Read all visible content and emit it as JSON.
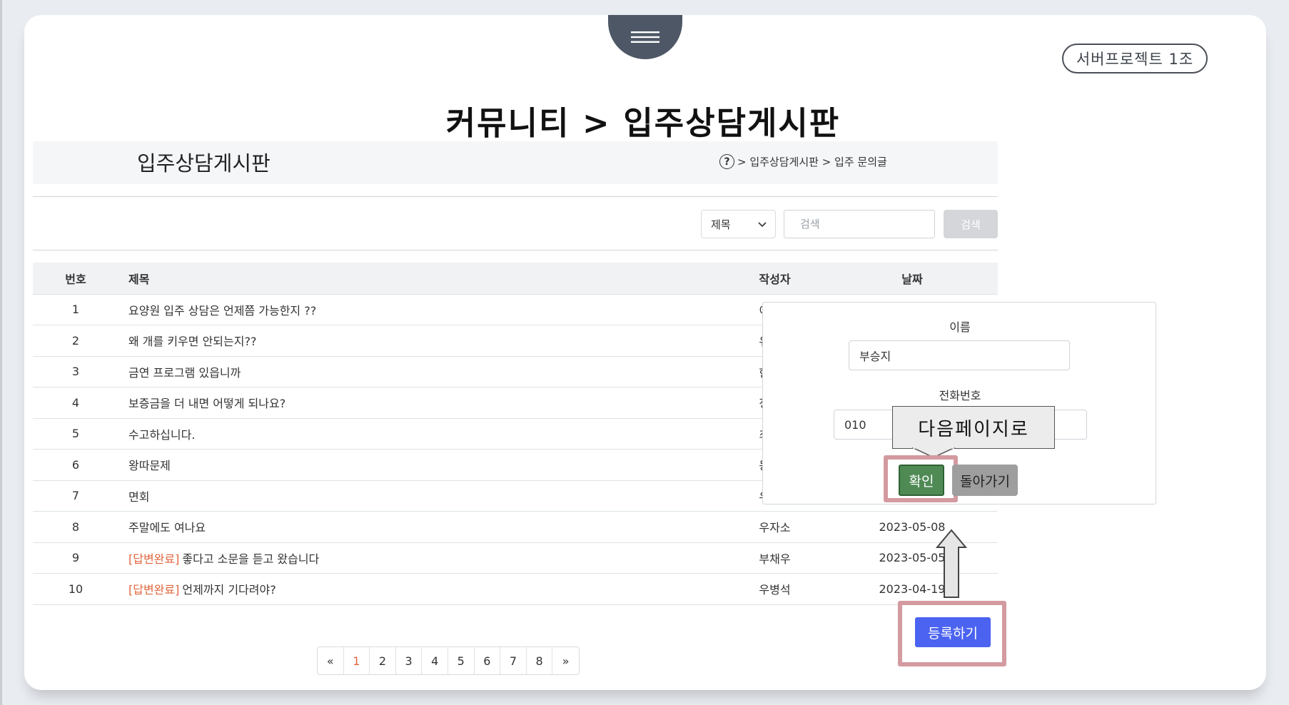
{
  "header": {
    "team_badge": "서버프로젝트 1조",
    "page_title": "커뮤니티 > 입주상담게시판"
  },
  "board": {
    "title": "입주상담게시판",
    "breadcrumb_icon": "?",
    "breadcrumb": "> 입주상담게시판 > 입주 문의글"
  },
  "search": {
    "select_value": "제목",
    "placeholder": "검색",
    "button_label": "검색"
  },
  "table": {
    "columns": [
      "번호",
      "제목",
      "작성자",
      "날짜"
    ],
    "rows": [
      {
        "no": "1",
        "tag": "",
        "title": "요양원 입주 상담은 언제쯤 가능한지 ??",
        "author": "이형우",
        "date": ""
      },
      {
        "no": "2",
        "tag": "",
        "title": "왜 개를 키우면 안되는지??",
        "author": "유영엽",
        "date": ""
      },
      {
        "no": "3",
        "tag": "",
        "title": "금연 프로그램 있읍니까",
        "author": "한동민",
        "date": ""
      },
      {
        "no": "4",
        "tag": "",
        "title": "보증금을 더 내면 어떻게 되나요?",
        "author": "정헤정",
        "date": ""
      },
      {
        "no": "5",
        "tag": "",
        "title": "수고하십니다.",
        "author": "최대대",
        "date": ""
      },
      {
        "no": "6",
        "tag": "",
        "title": "왕따문제",
        "author": "동석은",
        "date": ""
      },
      {
        "no": "7",
        "tag": "",
        "title": "면회",
        "author": "우기영",
        "date": ""
      },
      {
        "no": "8",
        "tag": "",
        "title": "주말에도 여나요",
        "author": "우자소",
        "date": "2023-05-08"
      },
      {
        "no": "9",
        "tag": "[답변완료]",
        "title": "좋다고 소문을 듣고 왔습니다",
        "author": "부채우",
        "date": "2023-05-05"
      },
      {
        "no": "10",
        "tag": "[답변완료]",
        "title": "언제까지 기다려야?",
        "author": "우병석",
        "date": "2023-04-19"
      }
    ]
  },
  "pagination": {
    "prev": "«",
    "pages": [
      "1",
      "2",
      "3",
      "4",
      "5",
      "6",
      "7",
      "8"
    ],
    "next": "»",
    "current": "1"
  },
  "modal": {
    "name_label": "이름",
    "name_value": "부승지",
    "phone_label": "전화번호",
    "phone_value": "010",
    "confirm_label": "확인",
    "back_label": "돌아가기"
  },
  "annotation": {
    "callout_text": "다음페이지로"
  },
  "register_label": "등록하기",
  "colors": {
    "accent_tag": "#e0663e",
    "register": "#4b63f0",
    "confirm": "#4f8a55",
    "highlight": "#d39aa0"
  }
}
